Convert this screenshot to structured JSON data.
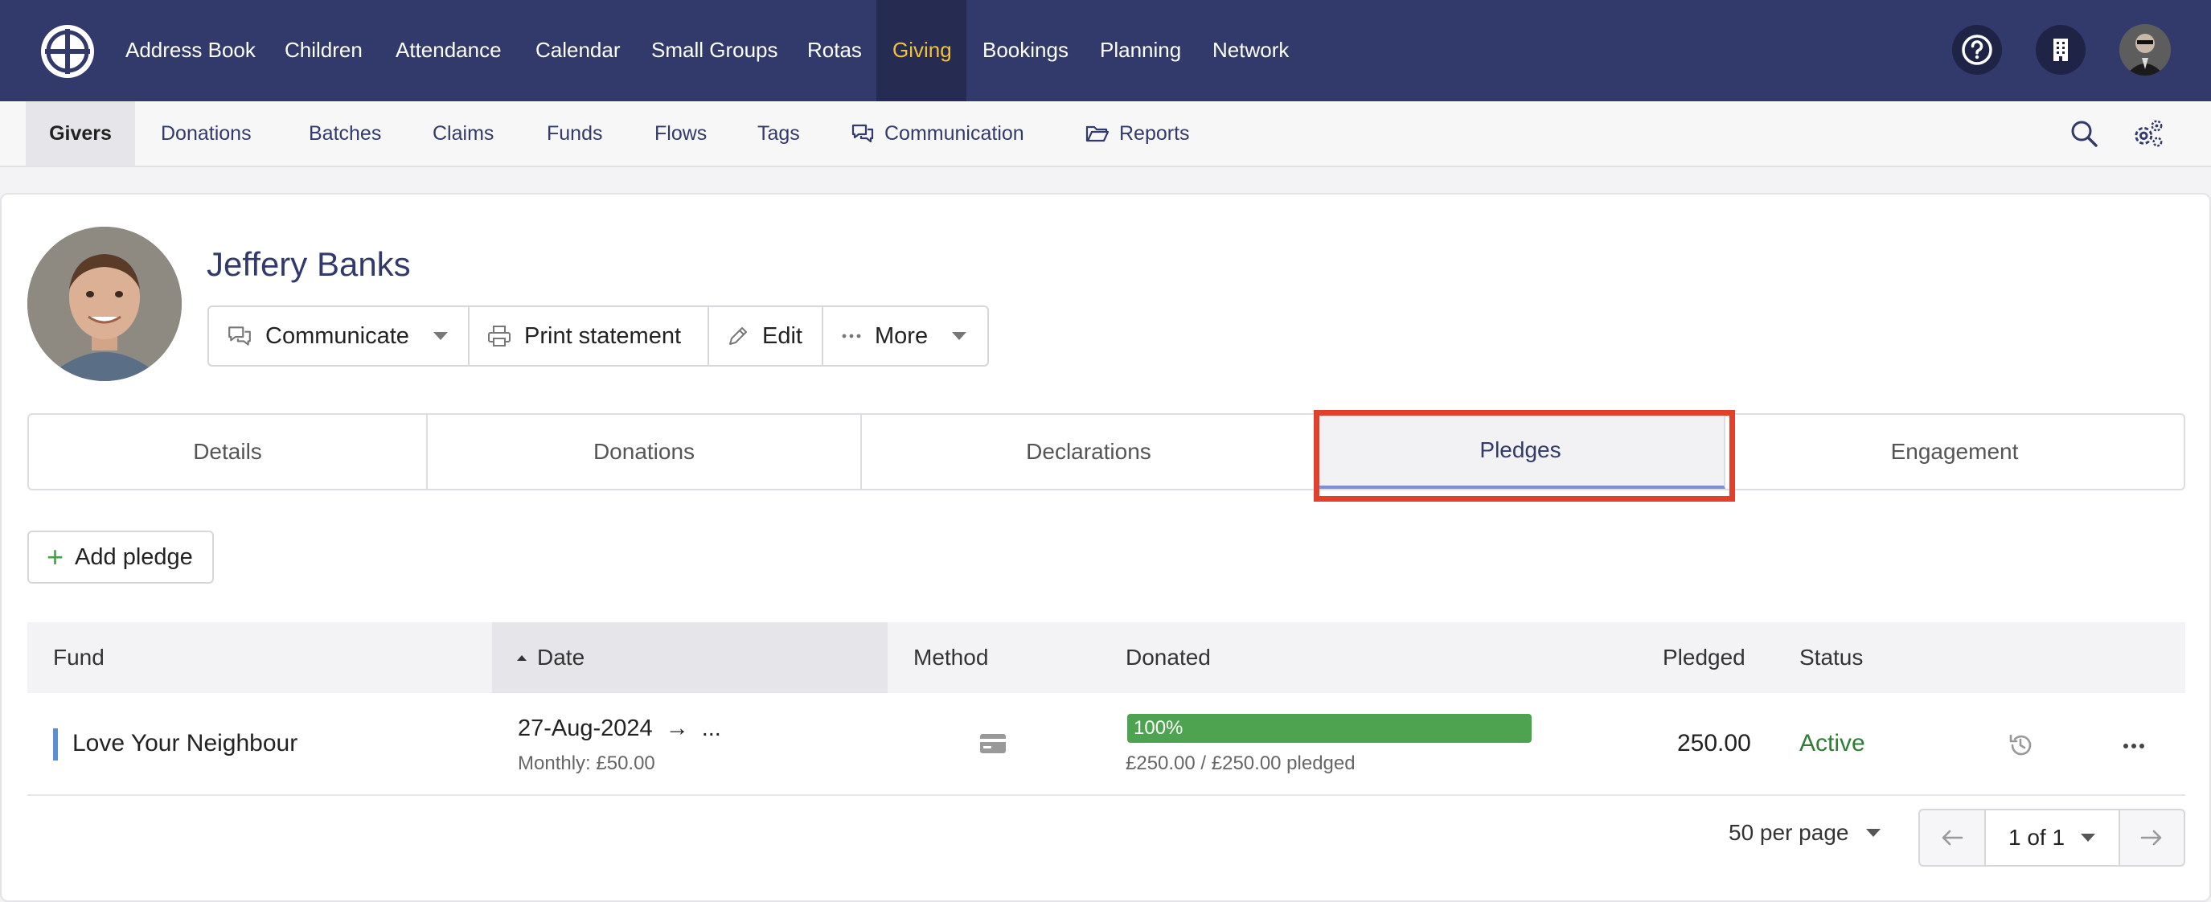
{
  "topnav": {
    "items": [
      "Address Book",
      "Children",
      "Attendance",
      "Calendar",
      "Small Groups",
      "Rotas",
      "Giving",
      "Bookings",
      "Planning",
      "Network"
    ],
    "active": "Giving",
    "icons": [
      "help-icon",
      "building-icon",
      "user-avatar"
    ]
  },
  "subnav": {
    "items": [
      "Givers",
      "Donations",
      "Batches",
      "Claims",
      "Funds",
      "Flows",
      "Tags",
      "Communication",
      "Reports"
    ],
    "active": "Givers"
  },
  "person": {
    "name": "Jeffery Banks"
  },
  "actions": {
    "communicate": "Communicate",
    "print": "Print statement",
    "edit": "Edit",
    "more": "More"
  },
  "tabs": [
    "Details",
    "Donations",
    "Declarations",
    "Pledges",
    "Engagement"
  ],
  "active_tab": "Pledges",
  "add_pledge": "Add pledge",
  "table": {
    "headers": [
      "Fund",
      "Date",
      "Method",
      "Donated",
      "Pledged",
      "Status"
    ],
    "sorted_column": "Date",
    "rows": [
      {
        "fund": "Love Your Neighbour",
        "date": "27-Aug-2024",
        "date_arrow": "→",
        "date_end": "...",
        "frequency": "Monthly: £50.00",
        "method_icon": "credit-card-icon",
        "progress_label": "100%",
        "progress_fraction": 1.0,
        "donated_text": "£250.00 / £250.00 pledged",
        "pledged": "250.00",
        "status": "Active"
      }
    ]
  },
  "pagination": {
    "per_page": "50 per page",
    "page": "1 of 1"
  },
  "colors": {
    "nav_bg": "#323a6b",
    "active_nav": "#f2c13d",
    "progress": "#4da34f",
    "status_active": "#2e7d32",
    "highlight": "#e0402c"
  }
}
